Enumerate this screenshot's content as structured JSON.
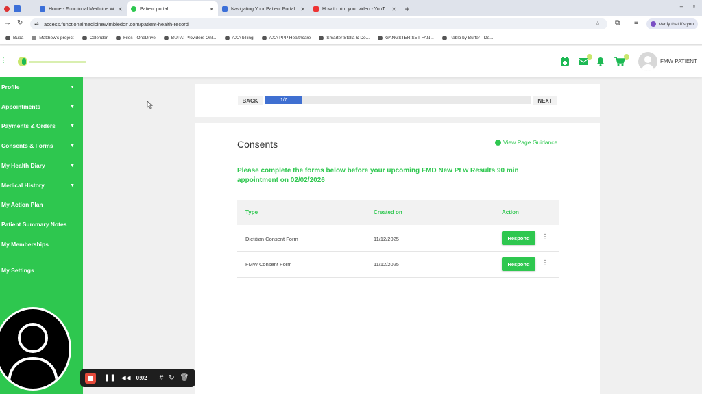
{
  "tabs": [
    {
      "label": "Home - Functional Medicine W...",
      "color": "#3b6fd8",
      "active": false
    },
    {
      "label": "Patient portal",
      "color": "#2ec74f",
      "active": true
    },
    {
      "label": "Navigating Your Patient Portal",
      "color": "#3b6fd8",
      "active": false
    },
    {
      "label": "How to trim your video - YouT...",
      "color": "#e33",
      "active": false
    }
  ],
  "address": {
    "url": "access.functionalmedicinewimbledon.com/patient-health-record",
    "verify": "Verify that it's you"
  },
  "bookmarks": [
    "Bupa",
    "Matthew's project",
    "Calendar",
    "Files - OneDrive",
    "BUPA: Providers Onl...",
    "AXA billing",
    "AXA PPP Healthcare",
    "Smarter Stella & Do...",
    "GANGSTER SET FAN...",
    "Pablo by Buffer - De..."
  ],
  "header": {
    "user_name": "FMW PATIENT",
    "badge_color": "#c8e66c",
    "accent": "#1db954"
  },
  "sidebar": {
    "items": [
      {
        "label": "Profile",
        "chevron": true
      },
      {
        "label": "Appointments",
        "chevron": true
      },
      {
        "label": "Payments & Orders",
        "chevron": true
      },
      {
        "label": "Consents & Forms",
        "chevron": true
      },
      {
        "label": "My Health Diary",
        "chevron": true
      },
      {
        "label": "Medical History",
        "chevron": true
      },
      {
        "label": "My Action Plan",
        "chevron": false
      },
      {
        "label": "Patient Summary Notes",
        "chevron": false
      },
      {
        "label": "My Memberships",
        "chevron": false
      },
      {
        "label": "My Settings",
        "chevron": false
      }
    ],
    "color": "#2ec74f"
  },
  "wizard": {
    "back_label": "BACK",
    "next_label": "NEXT",
    "step_text": "1/7",
    "progress_fraction": 0.1429
  },
  "consents": {
    "title": "Consents",
    "guidance_label": "View Page Guidance",
    "message": "Please complete the forms below before your upcoming FMD New Pt w Results 90 min appointment on 02/02/2026",
    "columns": [
      "Type",
      "Created on",
      "Action"
    ],
    "rows": [
      {
        "type": "Dietitian Consent Form",
        "created_on": "11/12/2025",
        "action": "Respond"
      },
      {
        "type": "FMW Consent Form",
        "created_on": "11/12/2025",
        "action": "Respond"
      }
    ]
  },
  "recorder": {
    "time": "0:02"
  }
}
